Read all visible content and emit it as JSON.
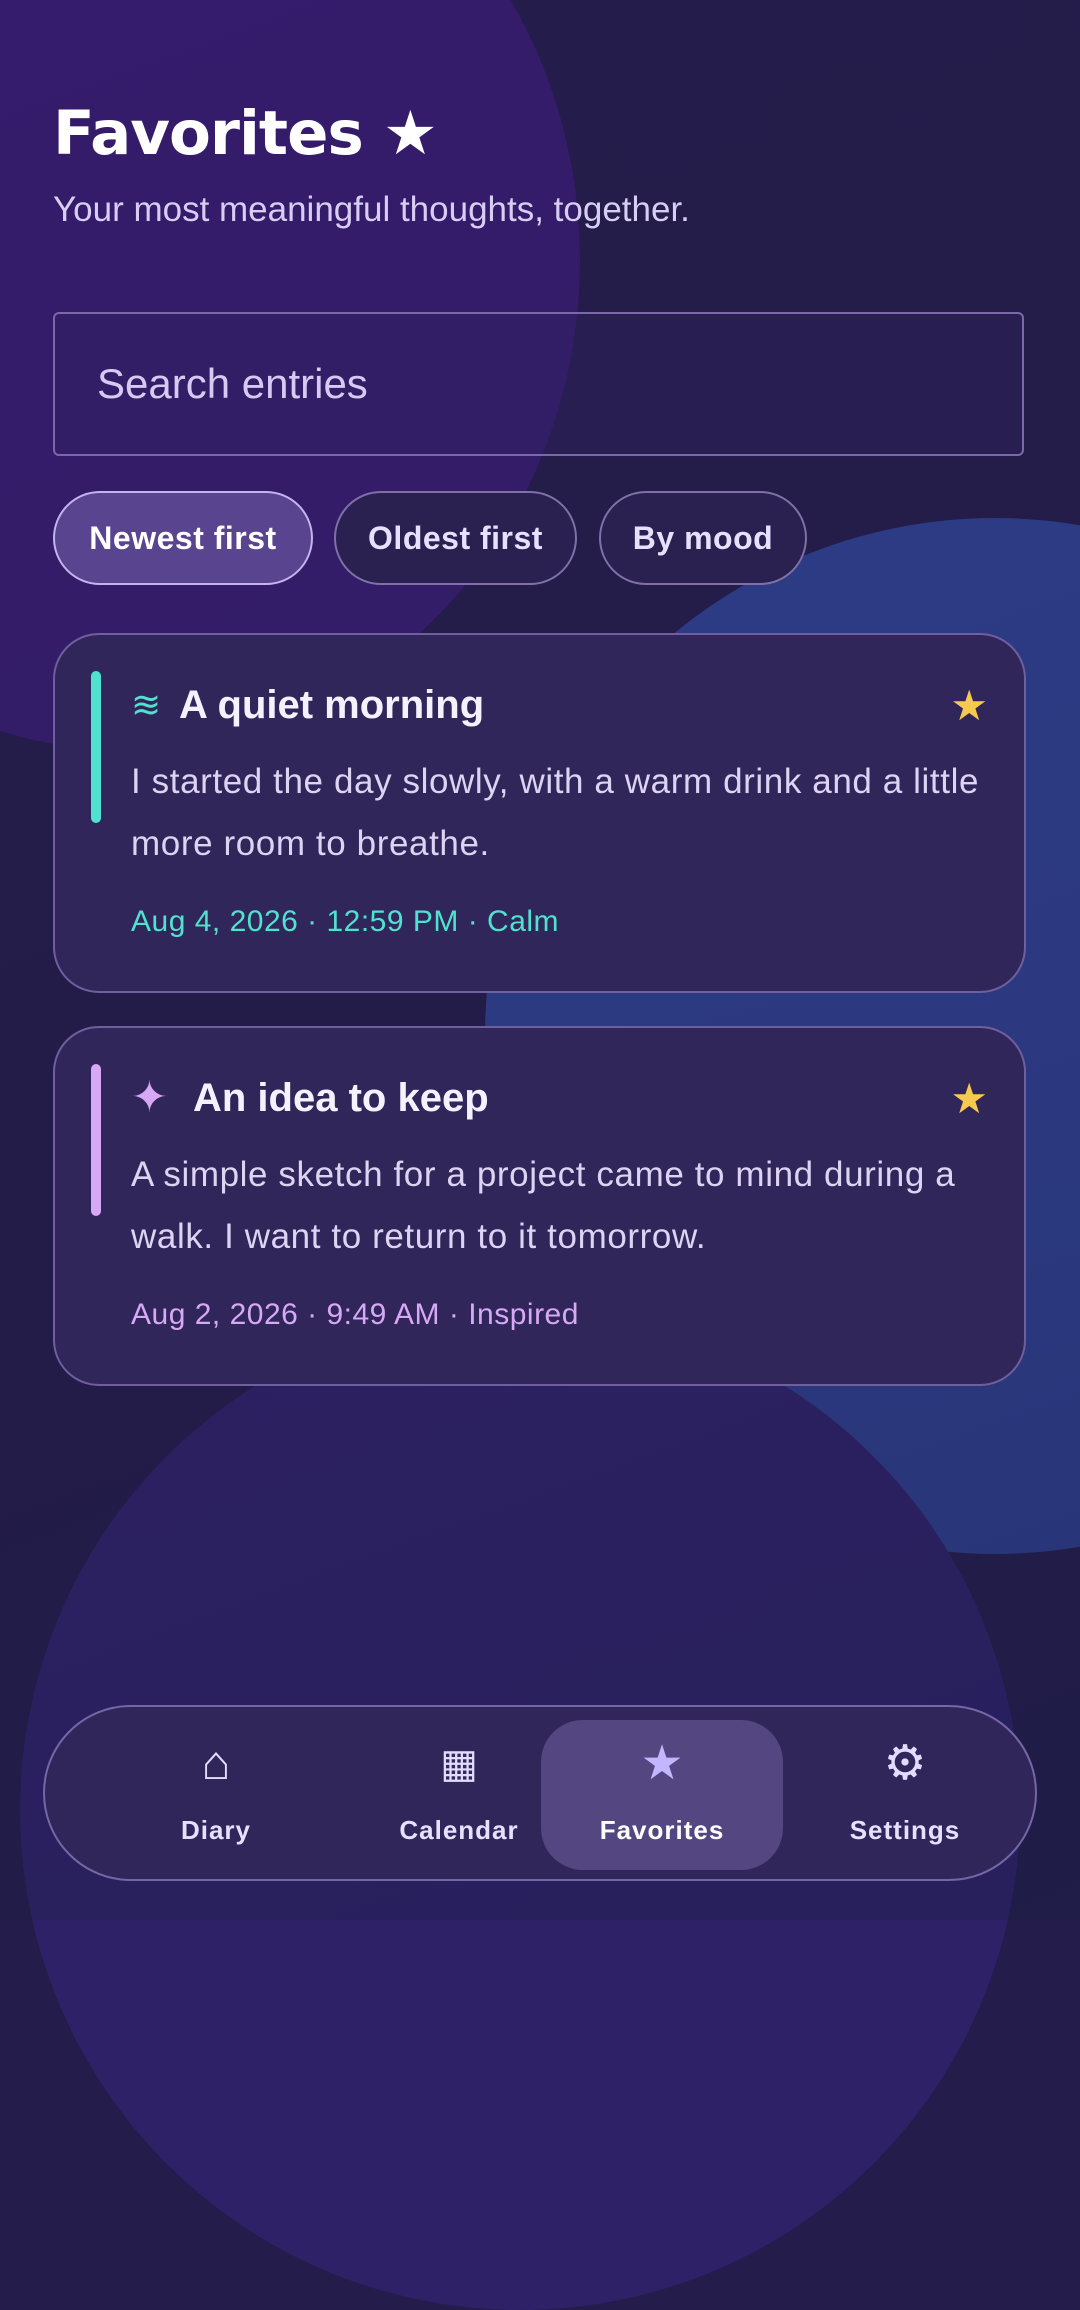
{
  "header": {
    "title": "Favorites ★",
    "subtitle": "Your most meaningful thoughts, together."
  },
  "search": {
    "placeholder": "Search entries",
    "value": ""
  },
  "sort_chips": [
    {
      "label": "Newest first",
      "selected": true
    },
    {
      "label": "Oldest first",
      "selected": false
    },
    {
      "label": "By mood",
      "selected": false
    }
  ],
  "entries": [
    {
      "mood_icon": "≋",
      "mood_icon_name": "waves-icon",
      "title": "A quiet morning",
      "body": "I started the day slowly, with a warm drink and a little more room to breathe.",
      "meta": "Aug 4, 2026 · 12:59 PM · Calm",
      "accent_color": "#4fe3cf",
      "favorite_icon": "★"
    },
    {
      "mood_icon": "✦",
      "mood_icon_name": "sparkle-icon",
      "title": "An idea to keep",
      "body": "A simple sketch for a project came to mind during a walk. I want to return to it tomorrow.",
      "meta": "Aug 2, 2026 · 9:49 AM · Inspired",
      "accent_color": "#d6a8f5",
      "favorite_icon": "★"
    }
  ],
  "nav": {
    "items": [
      {
        "icon": "⌂",
        "icon_name": "home-icon",
        "label": "Diary",
        "active": false
      },
      {
        "icon": "▦",
        "icon_name": "calendar-icon",
        "label": "Calendar",
        "active": false
      },
      {
        "icon": "★",
        "icon_name": "star-icon",
        "label": "Favorites",
        "active": true
      },
      {
        "icon": "⚙",
        "icon_name": "settings-icon",
        "label": "Settings",
        "active": false
      }
    ]
  },
  "colors": {
    "favorite_star": "#f6c94f",
    "active_nav_icon": "#c4b5ff"
  }
}
